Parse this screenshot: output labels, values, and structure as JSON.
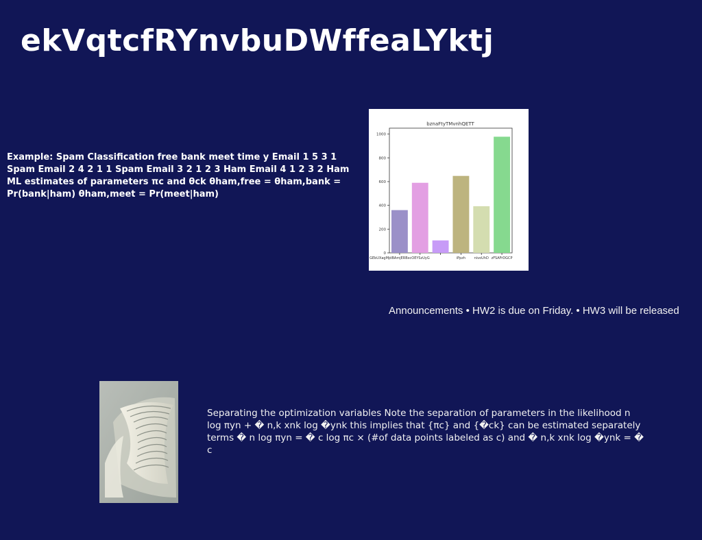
{
  "page": {
    "title": "ekVqtcfRYnvbuDWffeaLYktj"
  },
  "example": {
    "text": "Example: Spam Classification free bank meet time y Email 1 5 3 1 Spam Email 2 4 2 1 1 Spam Email 3 2 1 2 3 Ham Email 4 1 2 3 2 Ham ML estimates of parameters πc and θck θham,free = θham,bank = Pr(bank|ham) θham,meet = Pr(meet|ham)"
  },
  "announcement": {
    "text": "Announcements • HW2 is due on Friday. • HW3 will be released"
  },
  "separation": {
    "text": "Separating the optimization variables Note the separation of parameters in the likelihood n log πyn + � n,k xnk log �ynk this implies that {πc} and {�ck} can be estimated separately terms � n log πyn = � c log πc × (#of data points labeled as c) and � n,k xnk log �ynk = � c"
  },
  "photo": {
    "icon": "abstract-sculpture-photo"
  },
  "chart_data": {
    "type": "bar",
    "title": "bznaFtyTMvnhQETT",
    "categories": [
      "GEbUXagMjdBAmjERBxcOEYSzUyG",
      "iPpzh",
      "nivoUhD",
      "zFSAFrDGCP"
    ],
    "tick_label_indices": [
      0,
      3,
      4,
      5
    ],
    "values": [
      360,
      590,
      105,
      648,
      393,
      978
    ],
    "bar_colors": [
      "#9b90c8",
      "#e39fe3",
      "#c79bf7",
      "#bdb47f",
      "#d4ddb0",
      "#86d98f"
    ],
    "ylim": [
      0,
      1050
    ],
    "yticks": [
      0,
      200,
      400,
      600,
      800,
      1000
    ],
    "xlabel": "",
    "ylabel": "",
    "grid": false
  }
}
